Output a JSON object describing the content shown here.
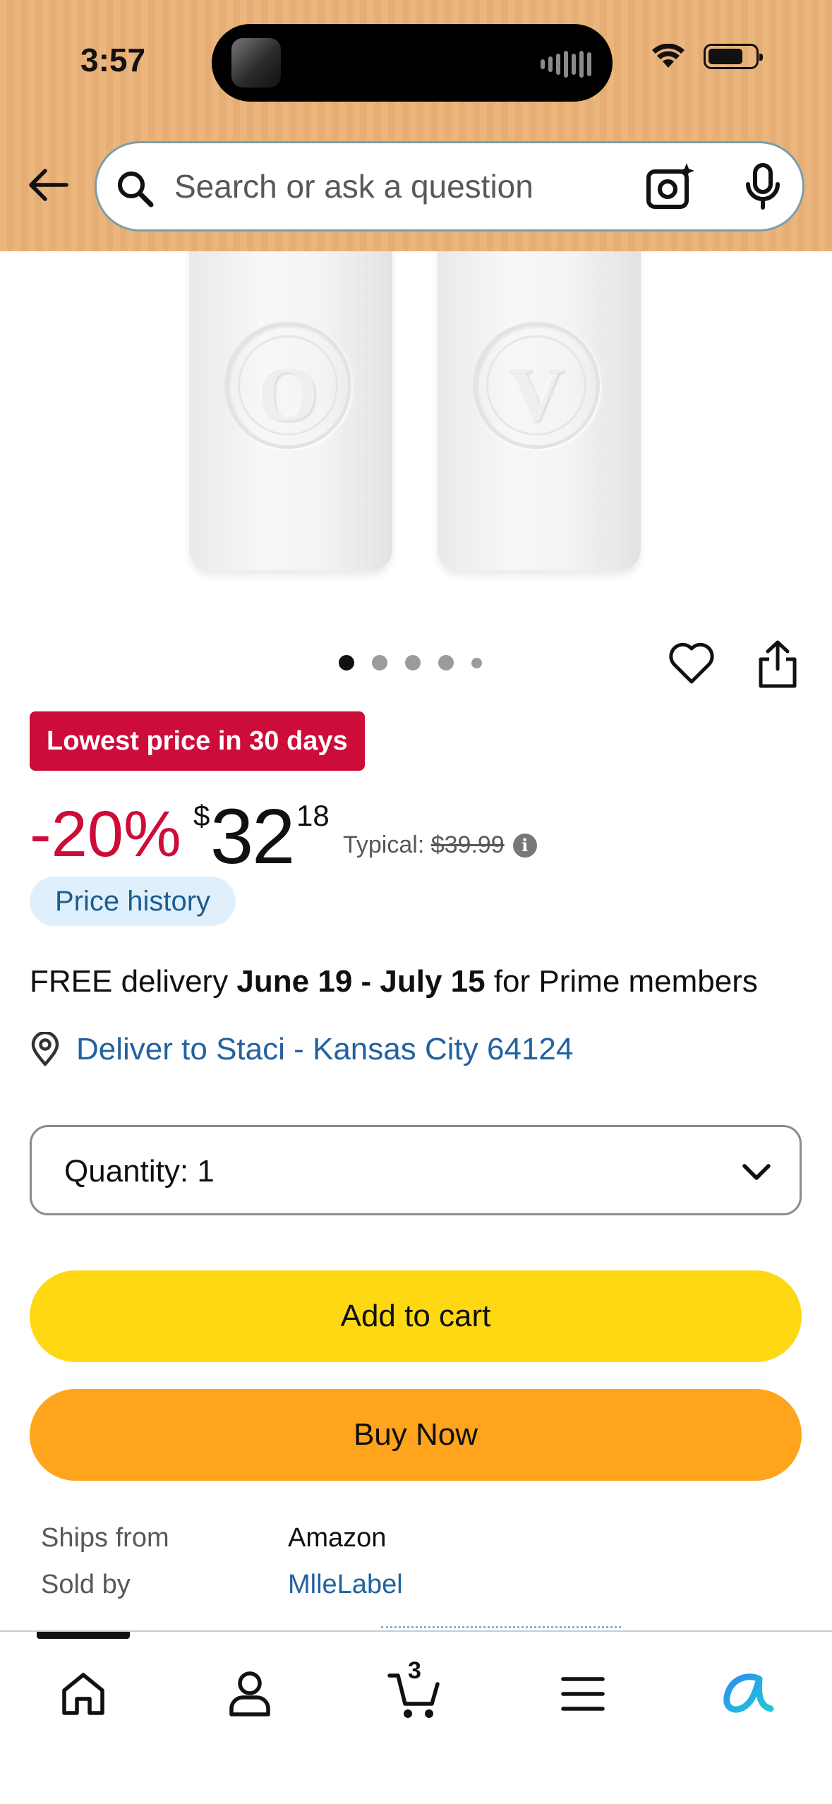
{
  "status_bar": {
    "time": "3:57"
  },
  "search": {
    "placeholder": "Search or ask a question"
  },
  "product_images": {
    "shaker_letters": [
      "O",
      "V"
    ],
    "carousel_dot_count": 5,
    "active_index": 0
  },
  "deal": {
    "badge": "Lowest price in 30 days"
  },
  "price": {
    "discount": "-20%",
    "currency_symbol": "$",
    "whole": "32",
    "fraction": "18",
    "typical_label": "Typical:",
    "typical_price": "$39.99",
    "history_button": "Price history"
  },
  "delivery": {
    "prefix": "FREE delivery ",
    "dates": "June 19 - July 15",
    "suffix": " for Prime members",
    "deliver_to": "Deliver to Staci - Kansas City 64124"
  },
  "quantity": {
    "label": "Quantity:",
    "value": "1"
  },
  "buttons": {
    "add_to_cart": "Add to cart",
    "buy_now": "Buy Now"
  },
  "seller": {
    "ships_from_label": "Ships from",
    "ships_from_value": "Amazon",
    "sold_by_label": "Sold by",
    "sold_by_value": "MlleLabel"
  },
  "bottom_nav": {
    "cart_count": "3",
    "items": [
      "home-icon",
      "profile-icon",
      "cart-icon",
      "menu-icon",
      "rufus-icon"
    ]
  },
  "colors": {
    "header_bg": "#ebb57e",
    "deal_red": "#cc0c39",
    "link_blue": "#2162a1",
    "cart_yellow": "#ffd814",
    "buy_orange": "#ffa41c",
    "price_history_bg": "#dff0fc"
  }
}
